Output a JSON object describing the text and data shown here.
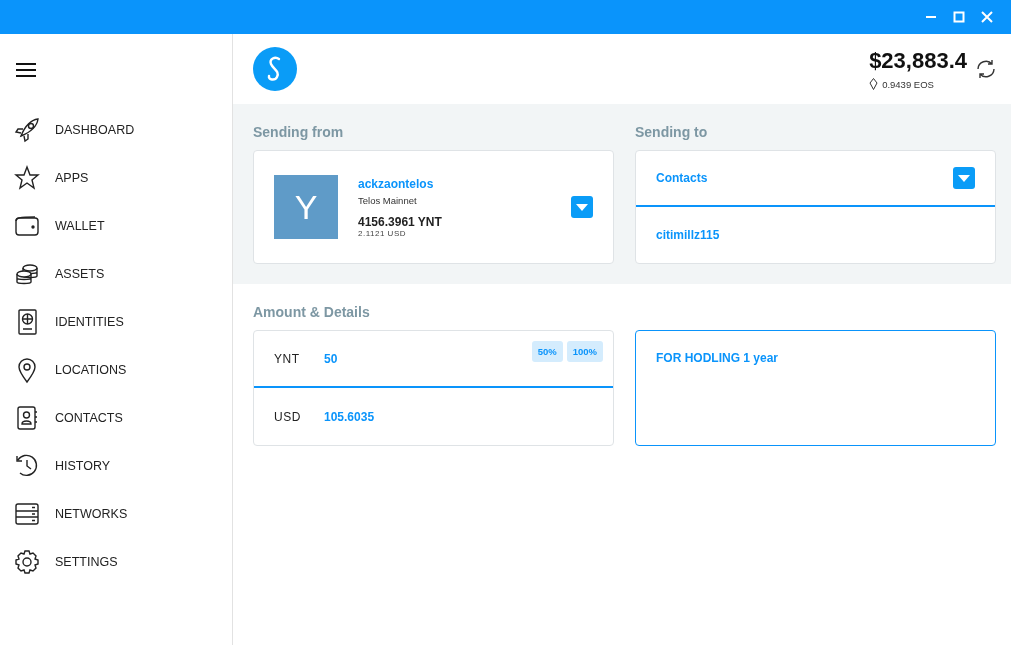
{
  "header": {
    "balance": "$23,883.4",
    "token_balance": "0.9439 EOS"
  },
  "sidebar": {
    "items": [
      {
        "label": "DASHBOARD"
      },
      {
        "label": "APPS"
      },
      {
        "label": "WALLET"
      },
      {
        "label": "ASSETS"
      },
      {
        "label": "IDENTITIES"
      },
      {
        "label": "LOCATIONS"
      },
      {
        "label": "CONTACTS"
      },
      {
        "label": "HISTORY"
      },
      {
        "label": "NETWORKS"
      },
      {
        "label": "SETTINGS"
      }
    ]
  },
  "sending_from": {
    "title": "Sending from",
    "avatar_letter": "Y",
    "account": "ackzaontelos",
    "network": "Telos Mainnet",
    "balance": "4156.3961 YNT",
    "fiat": "2.1121 USD"
  },
  "sending_to": {
    "title": "Sending to",
    "selector": "Contacts",
    "recipient": "citimillz115"
  },
  "amount": {
    "title": "Amount & Details",
    "token_label": "YNT",
    "token_value": "50",
    "fiat_label": "USD",
    "fiat_value": "105.6035",
    "presets": [
      "50%",
      "100%"
    ],
    "memo": "FOR HODLING 1 year"
  }
}
